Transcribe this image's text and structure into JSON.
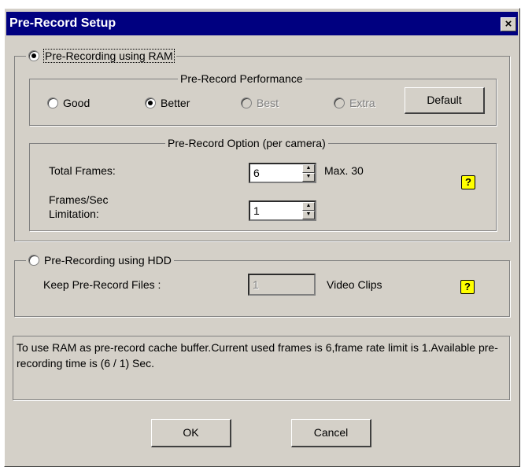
{
  "window": {
    "title": "Pre-Record Setup",
    "close_glyph": "×"
  },
  "ram_group": {
    "label": "Pre-Recording using RAM",
    "selected": true
  },
  "performance": {
    "label": "Pre-Record Performance",
    "options": [
      {
        "label": "Good",
        "selected": false,
        "enabled": true
      },
      {
        "label": "Better",
        "selected": true,
        "enabled": true
      },
      {
        "label": "Best",
        "selected": false,
        "enabled": false
      },
      {
        "label": "Extra",
        "selected": false,
        "enabled": false
      }
    ],
    "default_button": "Default"
  },
  "option_group": {
    "label": "Pre-Record Option (per camera)",
    "total_frames": {
      "label": "Total Frames:",
      "value": "6",
      "max_text": "Max. 30"
    },
    "fps_limit": {
      "label_line1": "Frames/Sec",
      "label_line2": "Limitation:",
      "value": "1"
    }
  },
  "hdd_group": {
    "label": "Pre-Recording using HDD",
    "selected": false,
    "keep_label": "Keep Pre-Record Files :",
    "keep_value": "1",
    "keep_unit": "Video Clips"
  },
  "help_icon_glyph": "?",
  "info_text": "To use RAM as pre-record cache buffer.Current used frames is 6,frame rate limit is 1.Available pre-recording time is (6 / 1) Sec.",
  "buttons": {
    "ok": "OK",
    "cancel": "Cancel"
  }
}
